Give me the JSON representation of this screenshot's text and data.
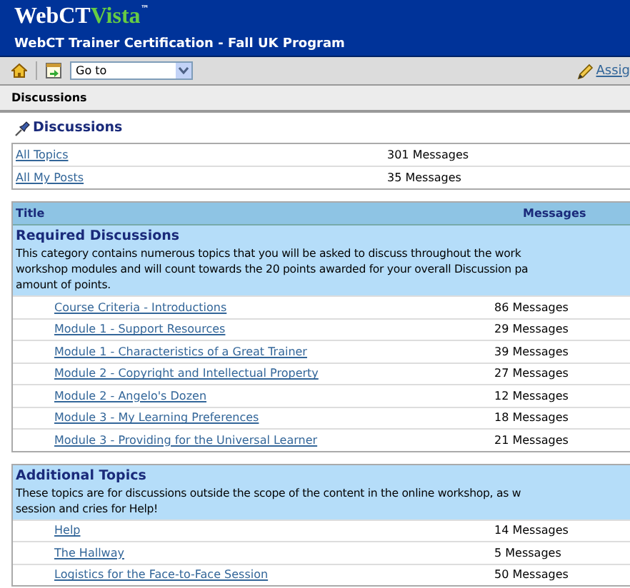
{
  "header": {
    "logo_primary": "WebCT",
    "logo_secondary": "Vista",
    "logo_mark": "™",
    "course_title": "WebCT Trainer Certification - Fall UK Program"
  },
  "toolbar": {
    "goto": {
      "value": "Go to"
    },
    "assign_link": "Assig"
  },
  "breadcrumb": "Discussions",
  "page_title": "Discussions",
  "summary": [
    {
      "label": "All Topics",
      "count": "301 Messages"
    },
    {
      "label": "All My Posts",
      "count": "35 Messages"
    }
  ],
  "categories": [
    {
      "columns": [
        "Title",
        "Messages"
      ],
      "title": "Required Discussions",
      "description_lines": [
        "This category contains numerous topics that you will be asked to discuss throughout the work",
        "workshop modules and will count towards the 20 points awarded for your overall Discussion pa",
        "amount of points."
      ],
      "topics": [
        {
          "title": "Course Criteria - Introductions",
          "count": "86 Messages"
        },
        {
          "title": "Module 1 - Support Resources",
          "count": "29 Messages"
        },
        {
          "title": "Module 1 - Characteristics of a Great Trainer",
          "count": "39 Messages"
        },
        {
          "title": "Module 2 - Copyright and Intellectual Property",
          "count": "27 Messages"
        },
        {
          "title": "Module 2 - Angelo's Dozen",
          "count": "12 Messages"
        },
        {
          "title": "Module 3 - My Learning Preferences",
          "count": "18 Messages"
        },
        {
          "title": "Module 3 - Providing for the Universal Learner",
          "count": "21 Messages"
        }
      ]
    },
    {
      "title": "Additional Topics",
      "description_lines": [
        "These topics are for discussions outside the scope of the content in the online workshop, as w",
        "session and cries for Help!"
      ],
      "topics": [
        {
          "title": "Help",
          "count": "14 Messages"
        },
        {
          "title": "The Hallway",
          "count": "5 Messages"
        },
        {
          "title": "Logistics for the Face-to-Face Session",
          "count": "50 Messages"
        }
      ]
    }
  ]
}
